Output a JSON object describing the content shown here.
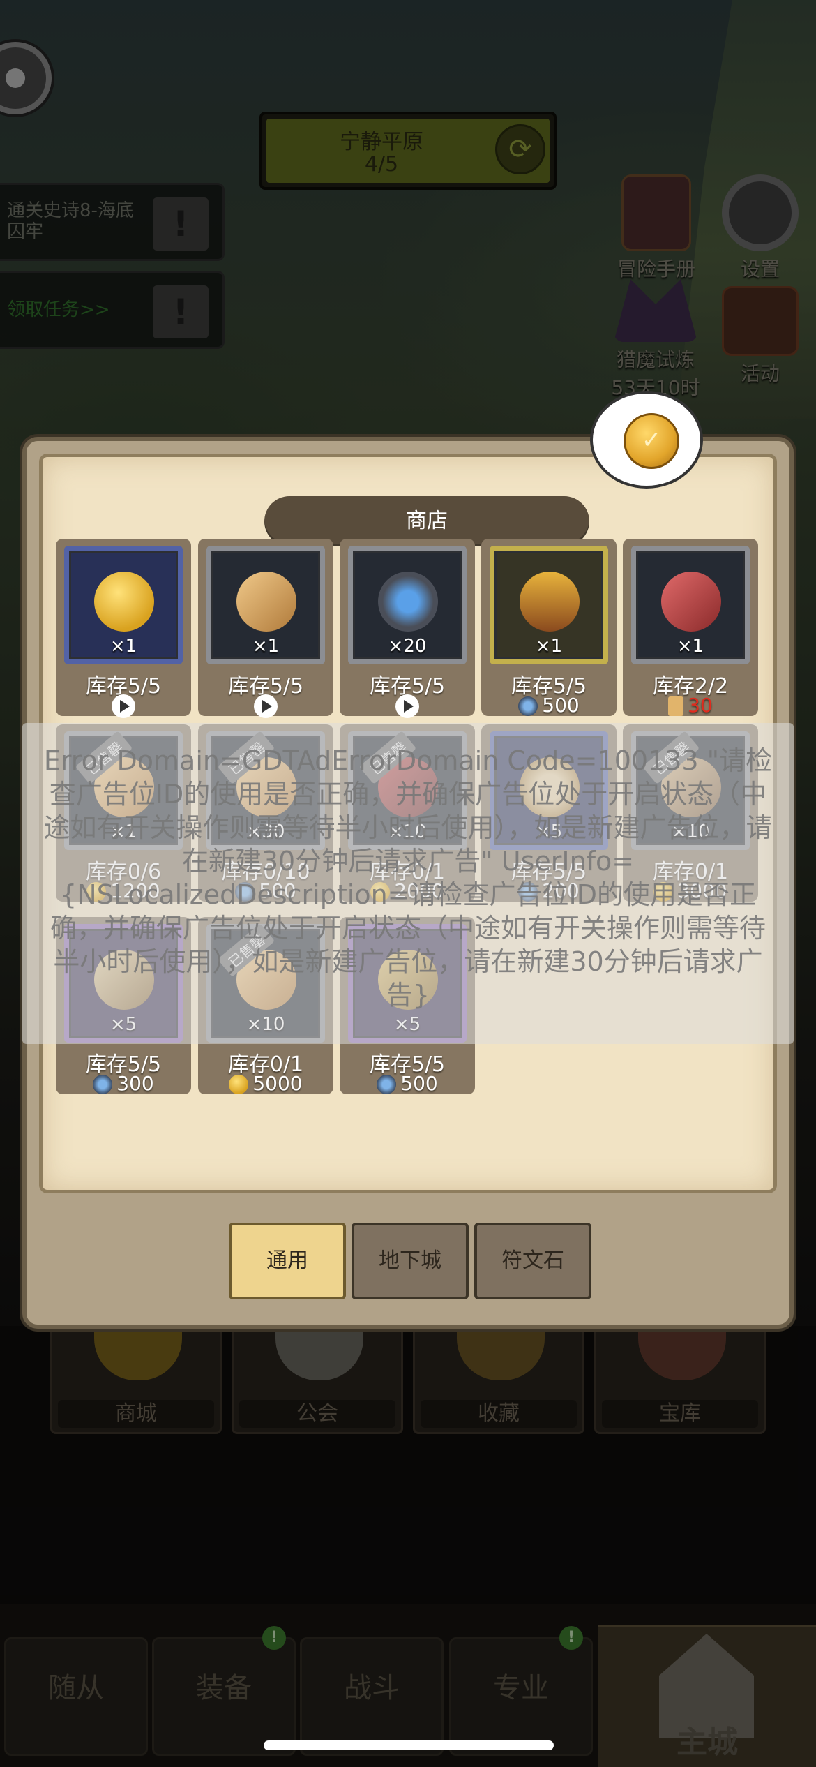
{
  "header": {
    "stage_title": "宁静平原",
    "stage_count": "4/5"
  },
  "quests": [
    {
      "text": "通关史诗8-海底囚牢",
      "badge": "!"
    },
    {
      "text": "领取任务>>",
      "badge": "!"
    }
  ],
  "right_icons": {
    "adventure_book": "冒险手册",
    "settings": "设置",
    "demon_trial": "猎魔试炼",
    "demon_trial_timer": "53天10时",
    "activity": "活动"
  },
  "shop": {
    "title": "商店",
    "rows": [
      [
        {
          "qty": "×1",
          "stock": "库存5/5",
          "price_type": "ad",
          "price": "",
          "frame": "blue",
          "item": "gold-coins"
        },
        {
          "qty": "×1",
          "stock": "库存5/5",
          "price_type": "ad",
          "price": "",
          "frame": "gray",
          "item": "scroll"
        },
        {
          "qty": "×20",
          "stock": "库存5/5",
          "price_type": "ad",
          "price": "",
          "frame": "gray",
          "item": "rune-stone"
        },
        {
          "qty": "×1",
          "stock": "库存5/5",
          "price_type": "gem",
          "price": "500",
          "frame": "gold",
          "item": "treasure-chest"
        },
        {
          "qty": "×1",
          "stock": "库存2/2",
          "price_type": "scroll",
          "price": "30",
          "frame": "gray",
          "item": "red-scroll"
        }
      ],
      [
        {
          "qty": "×1",
          "stock": "库存0/6",
          "price_type": "gold",
          "price": "1200",
          "frame": "gray",
          "item": "scroll",
          "sold": "已售罄"
        },
        {
          "qty": "×30",
          "stock": "库存0/10",
          "price_type": "gem",
          "price": "500",
          "frame": "gray",
          "item": "scroll",
          "sold": "已售罄"
        },
        {
          "qty": "×10",
          "stock": "库存0/1",
          "price_type": "gold",
          "price": "2000",
          "frame": "gray",
          "item": "cloth",
          "sold": "已售罄"
        },
        {
          "qty": "×5",
          "stock": "库存5/5",
          "price_type": "gem",
          "price": "200",
          "frame": "blue",
          "item": "rope"
        },
        {
          "qty": "×10",
          "stock": "库存0/1",
          "price_type": "gold",
          "price": "3000",
          "frame": "gray",
          "item": "hammer",
          "sold": "已售罄"
        }
      ],
      [
        {
          "qty": "×5",
          "stock": "库存5/5",
          "price_type": "gem",
          "price": "300",
          "frame": "purple",
          "item": "pickaxe"
        },
        {
          "qty": "×10",
          "stock": "库存0/1",
          "price_type": "gold",
          "price": "5000",
          "frame": "gray",
          "item": "scroll",
          "sold": "已售罄"
        },
        {
          "qty": "×5",
          "stock": "库存5/5",
          "price_type": "gem",
          "price": "500",
          "frame": "purple",
          "item": "map"
        }
      ]
    ],
    "tabs": [
      "通用",
      "地下城",
      "符文石"
    ],
    "active_tab": 0
  },
  "error_text": "Error Domain=GDTAdErrorDomain Code=100133 \"请检查广告位ID的使用是否正确，并确保广告位处于开启状态（中途如有开关操作则需等待半小时后使用），如是新建广告位，请在新建30分钟后请求广告\" UserInfo={NSLocalizedDescription=请检查广告位ID的使用是否正确，并确保广告位处于开启状态（中途如有开关操作则需等待半小时后使用），如是新建广告位，请在新建30分钟后请求广告}",
  "bottom_tiles": [
    "商城",
    "公会",
    "收藏",
    "宝库"
  ],
  "nav": {
    "tabs": [
      "随从",
      "装备",
      "战斗",
      "专业"
    ],
    "main": "主城",
    "badge": "!"
  },
  "colors": {
    "gem": "#7fb3e8",
    "gold": "#d9a21f",
    "scroll_price": "#e02b1e",
    "active_tab": "#eed48e"
  }
}
